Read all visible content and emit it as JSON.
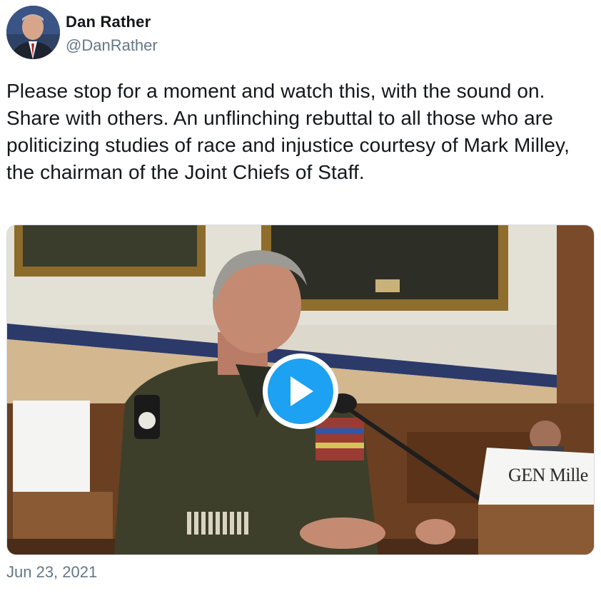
{
  "author": {
    "display_name": "Dan Rather",
    "handle": "@DanRather"
  },
  "tweet": {
    "text": "Please stop for a moment and watch this, with the sound on. Share with others. An unflinching rebuttal to all those who are politicizing studies of race and injustice courtesy of Mark Milley, the chairman of the Joint Chiefs of Staff.",
    "timestamp": "Jun 23, 2021"
  },
  "media": {
    "type": "video",
    "placard_text": "GEN Mille",
    "play_icon": "play-icon",
    "accent_color": "#1da1f2"
  },
  "colors": {
    "text_primary": "#14171a",
    "text_secondary": "#657786",
    "play_blue": "#1da1f2"
  }
}
